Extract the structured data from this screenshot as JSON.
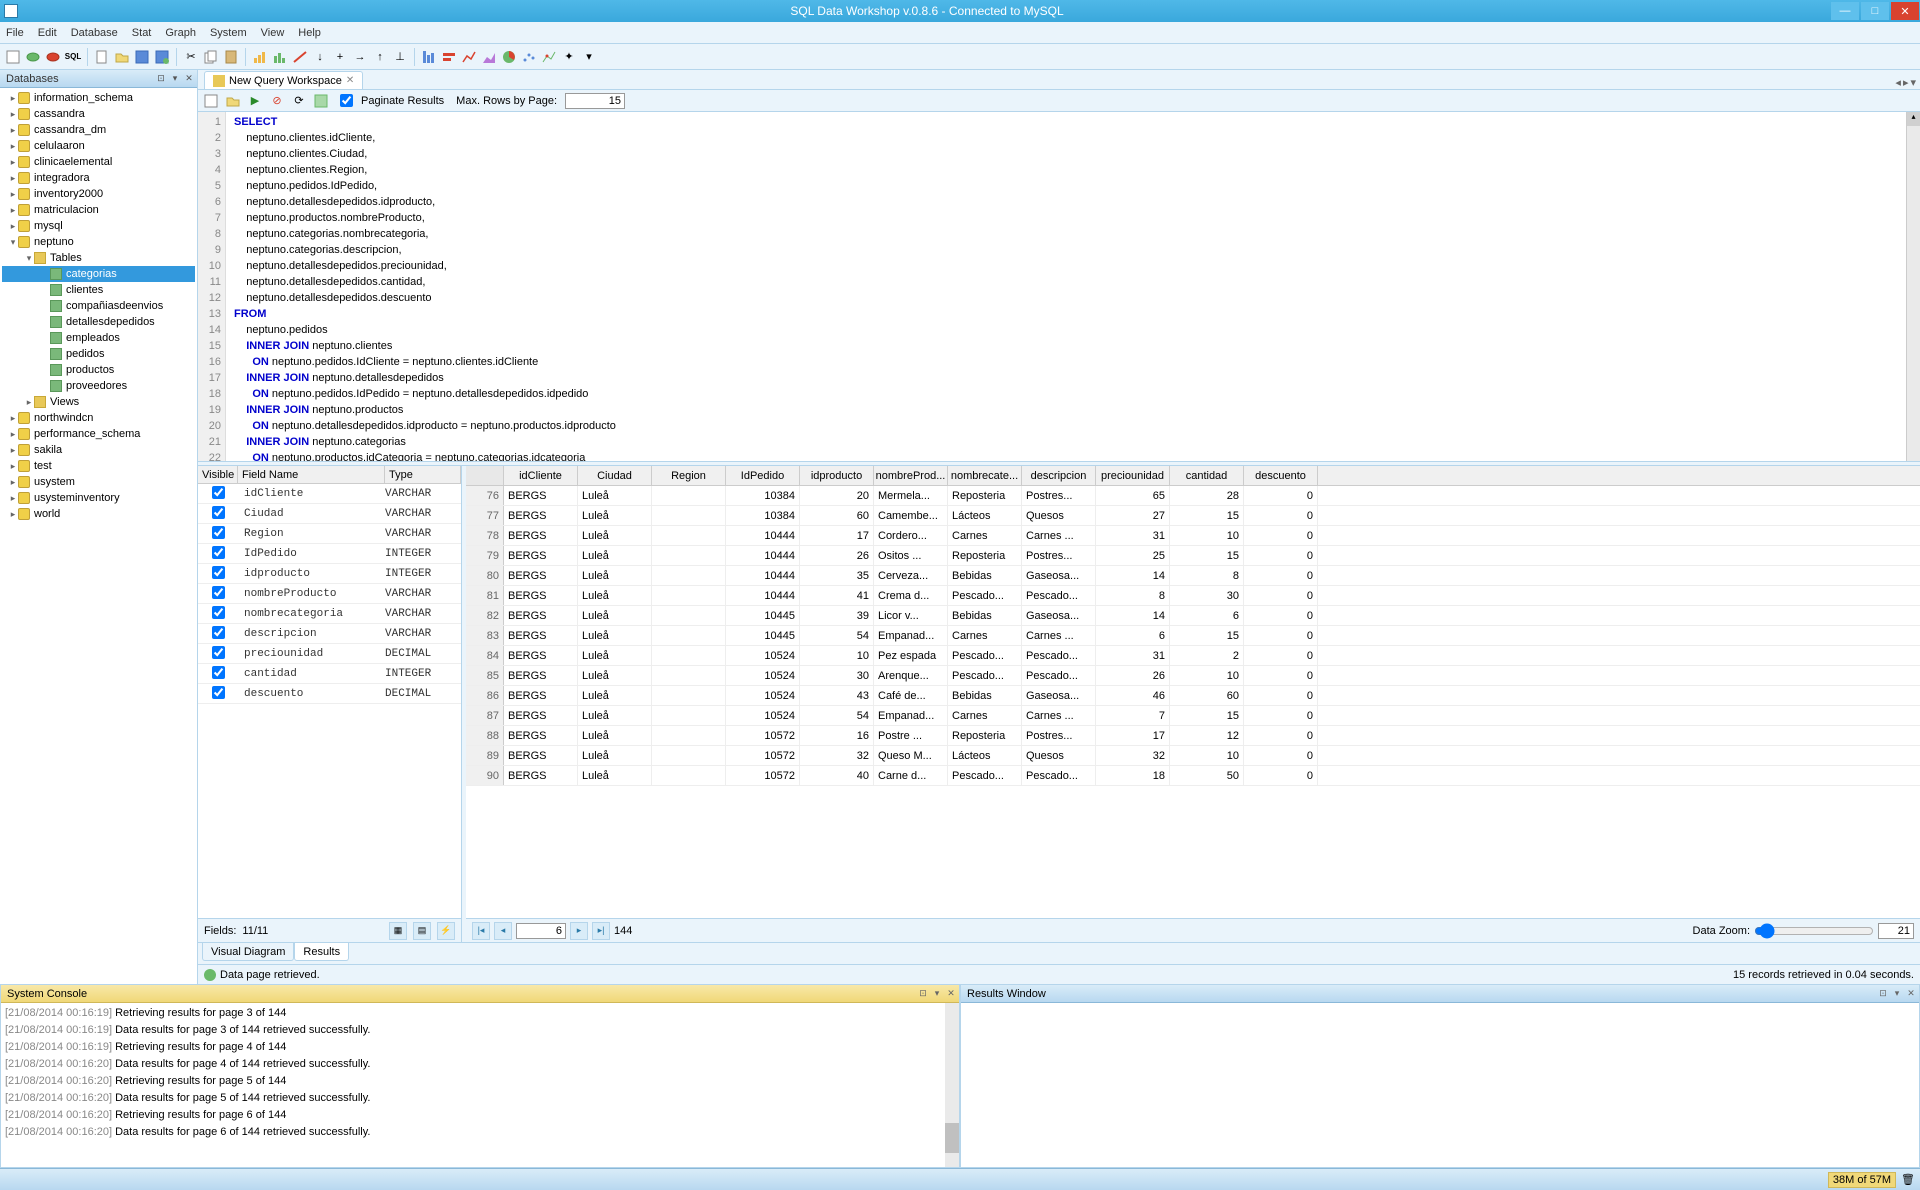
{
  "app": {
    "title": "SQL Data Workshop v.0.8.6 - Connected to MySQL"
  },
  "menu": [
    "File",
    "Edit",
    "Database",
    "Stat",
    "Graph",
    "System",
    "View",
    "Help"
  ],
  "sidebar": {
    "header": "Databases",
    "items": [
      {
        "label": "information_schema",
        "indent": 0,
        "type": "db"
      },
      {
        "label": "cassandra",
        "indent": 0,
        "type": "db"
      },
      {
        "label": "cassandra_dm",
        "indent": 0,
        "type": "db"
      },
      {
        "label": "celulaaron",
        "indent": 0,
        "type": "db"
      },
      {
        "label": "clinicaelemental",
        "indent": 0,
        "type": "db"
      },
      {
        "label": "integradora",
        "indent": 0,
        "type": "db"
      },
      {
        "label": "inventory2000",
        "indent": 0,
        "type": "db"
      },
      {
        "label": "matriculacion",
        "indent": 0,
        "type": "db"
      },
      {
        "label": "mysql",
        "indent": 0,
        "type": "db"
      },
      {
        "label": "neptuno",
        "indent": 0,
        "type": "db",
        "expanded": true
      },
      {
        "label": "Tables",
        "indent": 1,
        "type": "folder",
        "expanded": true
      },
      {
        "label": "categorias",
        "indent": 2,
        "type": "table",
        "selected": true
      },
      {
        "label": "clientes",
        "indent": 2,
        "type": "table"
      },
      {
        "label": "compañiasdeenvios",
        "indent": 2,
        "type": "table"
      },
      {
        "label": "detallesdepedidos",
        "indent": 2,
        "type": "table"
      },
      {
        "label": "empleados",
        "indent": 2,
        "type": "table"
      },
      {
        "label": "pedidos",
        "indent": 2,
        "type": "table"
      },
      {
        "label": "productos",
        "indent": 2,
        "type": "table"
      },
      {
        "label": "proveedores",
        "indent": 2,
        "type": "table"
      },
      {
        "label": "Views",
        "indent": 1,
        "type": "folder"
      },
      {
        "label": "northwindcn",
        "indent": 0,
        "type": "db"
      },
      {
        "label": "performance_schema",
        "indent": 0,
        "type": "db"
      },
      {
        "label": "sakila",
        "indent": 0,
        "type": "db"
      },
      {
        "label": "test",
        "indent": 0,
        "type": "db"
      },
      {
        "label": "usystem",
        "indent": 0,
        "type": "db"
      },
      {
        "label": "usysteminventory",
        "indent": 0,
        "type": "db"
      },
      {
        "label": "world",
        "indent": 0,
        "type": "db"
      }
    ]
  },
  "tabs": {
    "active": "New Query Workspace"
  },
  "queryToolbar": {
    "paginate_label": "Paginate Results",
    "paginate_checked": true,
    "maxrows_label": "Max. Rows by Page:",
    "maxrows_value": "15"
  },
  "editor": {
    "lines": [
      {
        "n": 1,
        "kw": "SELECT",
        "rest": ""
      },
      {
        "n": 2,
        "kw": "",
        "rest": "    neptuno.clientes.idCliente,"
      },
      {
        "n": 3,
        "kw": "",
        "rest": "    neptuno.clientes.Ciudad,"
      },
      {
        "n": 4,
        "kw": "",
        "rest": "    neptuno.clientes.Region,"
      },
      {
        "n": 5,
        "kw": "",
        "rest": "    neptuno.pedidos.IdPedido,"
      },
      {
        "n": 6,
        "kw": "",
        "rest": "    neptuno.detallesdepedidos.idproducto,"
      },
      {
        "n": 7,
        "kw": "",
        "rest": "    neptuno.productos.nombreProducto,"
      },
      {
        "n": 8,
        "kw": "",
        "rest": "    neptuno.categorias.nombrecategoria,"
      },
      {
        "n": 9,
        "kw": "",
        "rest": "    neptuno.categorias.descripcion,"
      },
      {
        "n": 10,
        "kw": "",
        "rest": "    neptuno.detallesdepedidos.preciounidad,"
      },
      {
        "n": 11,
        "kw": "",
        "rest": "    neptuno.detallesdepedidos.cantidad,"
      },
      {
        "n": 12,
        "kw": "",
        "rest": "    neptuno.detallesdepedidos.descuento"
      },
      {
        "n": 13,
        "kw": "FROM",
        "rest": ""
      },
      {
        "n": 14,
        "kw": "",
        "rest": "    neptuno.pedidos"
      },
      {
        "n": 15,
        "kw": "    INNER JOIN",
        "rest": " neptuno.clientes"
      },
      {
        "n": 16,
        "kw": "      ON",
        "rest": " neptuno.pedidos.IdCliente = neptuno.clientes.idCliente"
      },
      {
        "n": 17,
        "kw": "    INNER JOIN",
        "rest": " neptuno.detallesdepedidos"
      },
      {
        "n": 18,
        "kw": "      ON",
        "rest": " neptuno.pedidos.IdPedido = neptuno.detallesdepedidos.idpedido"
      },
      {
        "n": 19,
        "kw": "    INNER JOIN",
        "rest": " neptuno.productos"
      },
      {
        "n": 20,
        "kw": "      ON",
        "rest": " neptuno.detallesdepedidos.idproducto = neptuno.productos.idproducto"
      },
      {
        "n": 21,
        "kw": "    INNER JOIN",
        "rest": " neptuno.categorias"
      },
      {
        "n": 22,
        "kw": "      ON",
        "rest": " neptuno.productos.idCategoria = neptuno.categorias.idcategoria"
      }
    ]
  },
  "fields": {
    "header": {
      "visible": "Visible",
      "field": "Field Name",
      "type": "Type"
    },
    "items": [
      {
        "name": "idCliente",
        "type": "VARCHAR"
      },
      {
        "name": "Ciudad",
        "type": "VARCHAR"
      },
      {
        "name": "Region",
        "type": "VARCHAR"
      },
      {
        "name": "IdPedido",
        "type": "INTEGER"
      },
      {
        "name": "idproducto",
        "type": "INTEGER"
      },
      {
        "name": "nombreProducto",
        "type": "VARCHAR"
      },
      {
        "name": "nombrecategoria",
        "type": "VARCHAR"
      },
      {
        "name": "descripcion",
        "type": "VARCHAR"
      },
      {
        "name": "preciounidad",
        "type": "DECIMAL"
      },
      {
        "name": "cantidad",
        "type": "INTEGER"
      },
      {
        "name": "descuento",
        "type": "DECIMAL"
      }
    ],
    "footer": {
      "label": "Fields:",
      "count": "11/11"
    }
  },
  "grid": {
    "columns": [
      "idCliente",
      "Ciudad",
      "Region",
      "IdPedido",
      "idproducto",
      "nombreProd...",
      "nombrecate...",
      "descripcion",
      "preciounidad",
      "cantidad",
      "descuento"
    ],
    "rows": [
      {
        "n": 76,
        "idCliente": "BERGS",
        "Ciudad": "Luleå",
        "Region": "",
        "IdPedido": "10384",
        "idproducto": "20",
        "nomProd": "Mermela...",
        "nomCat": "Reposteria",
        "desc": "Postres...",
        "prec": "65",
        "cant": "28",
        "descto": "0"
      },
      {
        "n": 77,
        "idCliente": "BERGS",
        "Ciudad": "Luleå",
        "Region": "",
        "IdPedido": "10384",
        "idproducto": "60",
        "nomProd": "Camembe...",
        "nomCat": "Lácteos",
        "desc": "Quesos",
        "prec": "27",
        "cant": "15",
        "descto": "0"
      },
      {
        "n": 78,
        "idCliente": "BERGS",
        "Ciudad": "Luleå",
        "Region": "",
        "IdPedido": "10444",
        "idproducto": "17",
        "nomProd": "Cordero...",
        "nomCat": "Carnes",
        "desc": "Carnes ...",
        "prec": "31",
        "cant": "10",
        "descto": "0"
      },
      {
        "n": 79,
        "idCliente": "BERGS",
        "Ciudad": "Luleå",
        "Region": "",
        "IdPedido": "10444",
        "idproducto": "26",
        "nomProd": "Ositos ...",
        "nomCat": "Reposteria",
        "desc": "Postres...",
        "prec": "25",
        "cant": "15",
        "descto": "0"
      },
      {
        "n": 80,
        "idCliente": "BERGS",
        "Ciudad": "Luleå",
        "Region": "",
        "IdPedido": "10444",
        "idproducto": "35",
        "nomProd": "Cerveza...",
        "nomCat": "Bebidas",
        "desc": "Gaseosa...",
        "prec": "14",
        "cant": "8",
        "descto": "0"
      },
      {
        "n": 81,
        "idCliente": "BERGS",
        "Ciudad": "Luleå",
        "Region": "",
        "IdPedido": "10444",
        "idproducto": "41",
        "nomProd": "Crema d...",
        "nomCat": "Pescado...",
        "desc": "Pescado...",
        "prec": "8",
        "cant": "30",
        "descto": "0"
      },
      {
        "n": 82,
        "idCliente": "BERGS",
        "Ciudad": "Luleå",
        "Region": "",
        "IdPedido": "10445",
        "idproducto": "39",
        "nomProd": "Licor v...",
        "nomCat": "Bebidas",
        "desc": "Gaseosa...",
        "prec": "14",
        "cant": "6",
        "descto": "0"
      },
      {
        "n": 83,
        "idCliente": "BERGS",
        "Ciudad": "Luleå",
        "Region": "",
        "IdPedido": "10445",
        "idproducto": "54",
        "nomProd": "Empanad...",
        "nomCat": "Carnes",
        "desc": "Carnes ...",
        "prec": "6",
        "cant": "15",
        "descto": "0"
      },
      {
        "n": 84,
        "idCliente": "BERGS",
        "Ciudad": "Luleå",
        "Region": "",
        "IdPedido": "10524",
        "idproducto": "10",
        "nomProd": "Pez espada",
        "nomCat": "Pescado...",
        "desc": "Pescado...",
        "prec": "31",
        "cant": "2",
        "descto": "0"
      },
      {
        "n": 85,
        "idCliente": "BERGS",
        "Ciudad": "Luleå",
        "Region": "",
        "IdPedido": "10524",
        "idproducto": "30",
        "nomProd": "Arenque...",
        "nomCat": "Pescado...",
        "desc": "Pescado...",
        "prec": "26",
        "cant": "10",
        "descto": "0"
      },
      {
        "n": 86,
        "idCliente": "BERGS",
        "Ciudad": "Luleå",
        "Region": "",
        "IdPedido": "10524",
        "idproducto": "43",
        "nomProd": "Café de...",
        "nomCat": "Bebidas",
        "desc": "Gaseosa...",
        "prec": "46",
        "cant": "60",
        "descto": "0"
      },
      {
        "n": 87,
        "idCliente": "BERGS",
        "Ciudad": "Luleå",
        "Region": "",
        "IdPedido": "10524",
        "idproducto": "54",
        "nomProd": "Empanad...",
        "nomCat": "Carnes",
        "desc": "Carnes ...",
        "prec": "7",
        "cant": "15",
        "descto": "0"
      },
      {
        "n": 88,
        "idCliente": "BERGS",
        "Ciudad": "Luleå",
        "Region": "",
        "IdPedido": "10572",
        "idproducto": "16",
        "nomProd": "Postre ...",
        "nomCat": "Reposteria",
        "desc": "Postres...",
        "prec": "17",
        "cant": "12",
        "descto": "0"
      },
      {
        "n": 89,
        "idCliente": "BERGS",
        "Ciudad": "Luleå",
        "Region": "",
        "IdPedido": "10572",
        "idproducto": "32",
        "nomProd": "Queso M...",
        "nomCat": "Lácteos",
        "desc": "Quesos",
        "prec": "32",
        "cant": "10",
        "descto": "0"
      },
      {
        "n": 90,
        "idCliente": "BERGS",
        "Ciudad": "Luleå",
        "Region": "",
        "IdPedido": "10572",
        "idproducto": "40",
        "nomProd": "Carne d...",
        "nomCat": "Pescado...",
        "desc": "Pescado...",
        "prec": "18",
        "cant": "50",
        "descto": "0"
      }
    ],
    "footer": {
      "page": "6",
      "total": "144",
      "zoom_label": "Data Zoom:",
      "zoom_value": "21"
    }
  },
  "bottomTabs": [
    "Visual Diagram",
    "Results"
  ],
  "status": {
    "msg": "Data page retrieved.",
    "records": "15 records retrieved in 0.04 seconds."
  },
  "console": {
    "header": "System Console",
    "lines": [
      {
        "ts": "[21/08/2014 00:16:19]",
        "msg": "Retrieving results for page 3 of 144"
      },
      {
        "ts": "[21/08/2014 00:16:19]",
        "msg": "Data results for page 3 of 144 retrieved successfully."
      },
      {
        "ts": "[21/08/2014 00:16:19]",
        "msg": "Retrieving results for page 4 of 144"
      },
      {
        "ts": "[21/08/2014 00:16:20]",
        "msg": "Data results for page 4 of 144 retrieved successfully."
      },
      {
        "ts": "[21/08/2014 00:16:20]",
        "msg": "Retrieving results for page 5 of 144"
      },
      {
        "ts": "[21/08/2014 00:16:20]",
        "msg": "Data results for page 5 of 144 retrieved successfully."
      },
      {
        "ts": "[21/08/2014 00:16:20]",
        "msg": "Retrieving results for page 6 of 144"
      },
      {
        "ts": "[21/08/2014 00:16:20]",
        "msg": "Data results for page 6 of 144 retrieved successfully."
      }
    ]
  },
  "resultsWindow": {
    "header": "Results Window"
  },
  "statusbar": {
    "mem": "38M of 57M"
  }
}
